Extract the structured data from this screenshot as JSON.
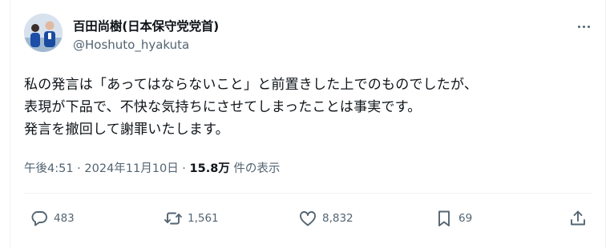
{
  "author": {
    "display_name": "百田尚樹(日本保守党党首)",
    "handle": "@Hoshuto_hyakuta"
  },
  "post": {
    "lines": [
      "私の発言は「あってはならないこと」と前置きした上でのものでしたが、",
      "表現が下品で、不快な気持ちにさせてしまったことは事実です。",
      "発言を撤回して謝罪いたします。"
    ],
    "time": "午後4:51",
    "date": "2024年11月10日",
    "views_count": "15.8万",
    "views_label": "件の表示"
  },
  "actions": {
    "replies": "483",
    "reposts": "1,561",
    "likes": "8,832",
    "bookmarks": "69"
  },
  "icons": [
    "reply-icon",
    "repost-icon",
    "like-icon",
    "bookmark-icon",
    "share-icon",
    "more-icon"
  ],
  "colors": {
    "text": "#0f1419",
    "secondary": "#536471",
    "divider": "#eff3f4"
  }
}
